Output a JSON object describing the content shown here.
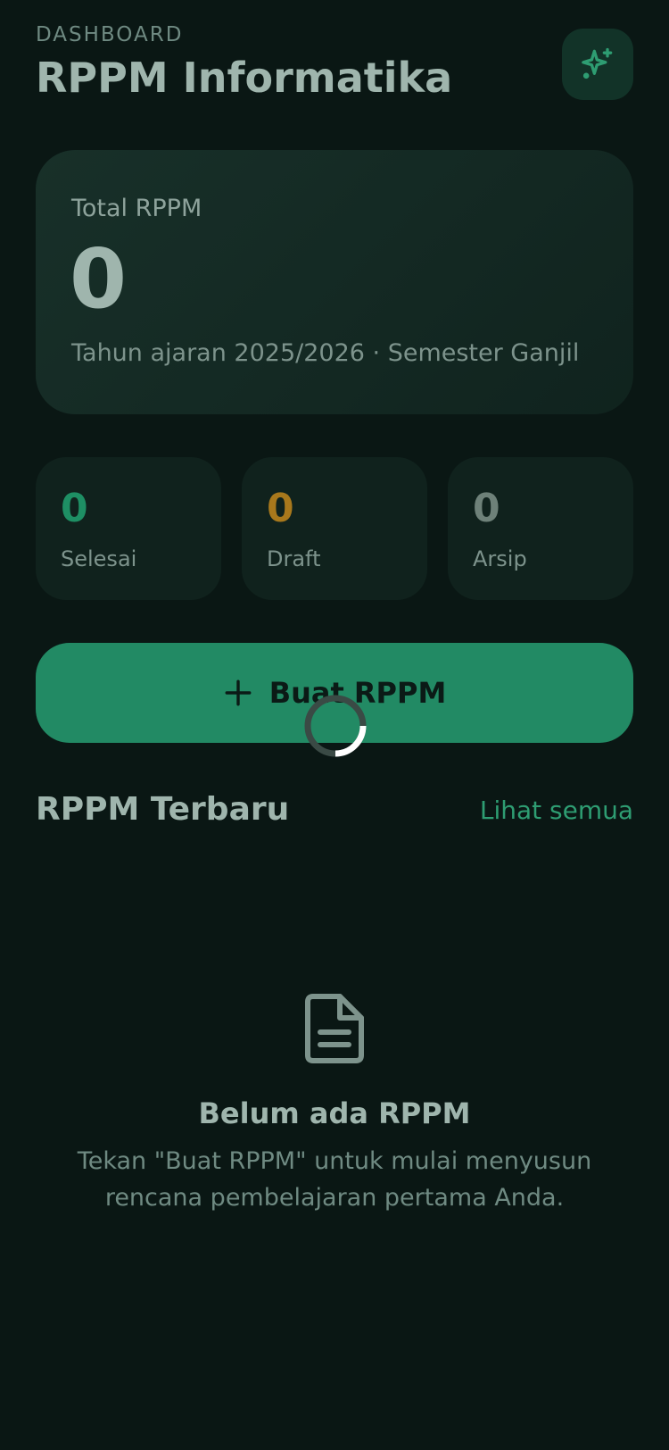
{
  "header": {
    "eyebrow": "DASHBOARD",
    "title": "RPPM Informatika",
    "ai_icon": "sparkles-icon"
  },
  "summary": {
    "label": "Total RPPM",
    "value": "0",
    "subtitle": "Tahun ajaran 2025/2026 · Semester Ganjil"
  },
  "stats": [
    {
      "value": "0",
      "label": "Selesai",
      "color": "#1e8f64"
    },
    {
      "value": "0",
      "label": "Draft",
      "color": "#a8781c"
    },
    {
      "value": "0",
      "label": "Arsip",
      "color": "#6e8179"
    }
  ],
  "create_button": {
    "icon": "plus-icon",
    "label": "Buat RPPM"
  },
  "recent": {
    "title": "RPPM Terbaru",
    "see_all": "Lihat semua"
  },
  "empty_state": {
    "icon": "document-icon",
    "title": "Belum ada RPPM",
    "description": "Tekan \"Buat RPPM\" untuk mulai menyusun rencana pembelajaran pertama Anda."
  },
  "colors": {
    "background": "#0a1714",
    "accent": "#228a64",
    "link": "#2e9d72"
  }
}
